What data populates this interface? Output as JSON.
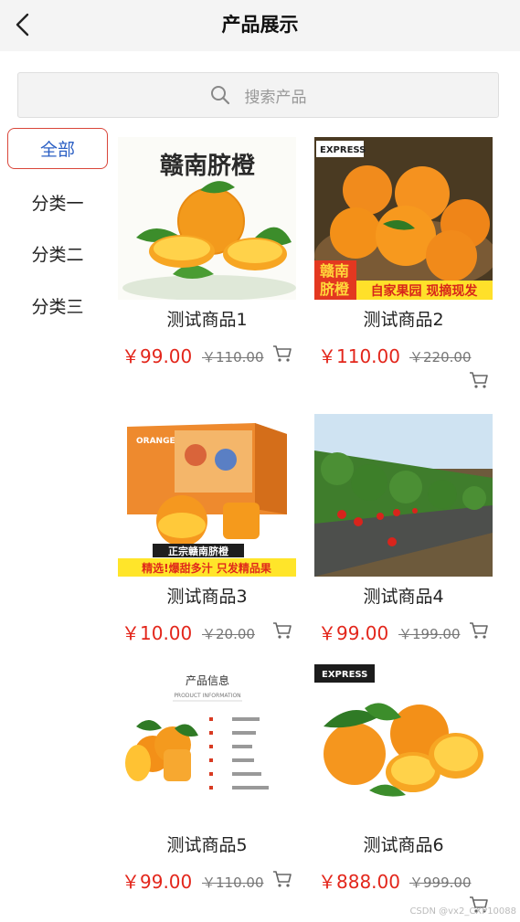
{
  "header": {
    "title": "产品展示",
    "back_icon": "chevron-left-icon"
  },
  "search": {
    "placeholder": "搜索产品",
    "icon": "search-icon"
  },
  "categories": [
    {
      "label": "全部",
      "active": true
    },
    {
      "label": "分类一",
      "active": false
    },
    {
      "label": "分类二",
      "active": false
    },
    {
      "label": "分类三",
      "active": false
    }
  ],
  "products": [
    {
      "name": "测试商品1",
      "price": "￥99.00",
      "old_price": "￥110.00",
      "image_text": [
        "赣南脐橙"
      ]
    },
    {
      "name": "测试商品2",
      "price": "￥110.00",
      "old_price": "￥220.00",
      "image_text": [
        "赣南",
        "脐橙",
        "自家果园 现摘现发",
        "EXPRESS"
      ]
    },
    {
      "name": "测试商品3",
      "price": "￥10.00",
      "old_price": "￥20.00",
      "image_text": [
        "正宗赣南脐橙",
        "精选!爆甜多汁 只发精品果",
        "ORANGE"
      ]
    },
    {
      "name": "测试商品4",
      "price": "￥99.00",
      "old_price": "￥199.00",
      "image_text": []
    },
    {
      "name": "测试商品5",
      "price": "￥99.00",
      "old_price": "￥110.00",
      "image_text": [
        "产品信息",
        "PRODUCT INFORMATION"
      ]
    },
    {
      "name": "测试商品6",
      "price": "￥888.00",
      "old_price": "￥999.00",
      "image_text": [
        "EXPRESS"
      ]
    }
  ],
  "colors": {
    "price": "#e3261b",
    "active_border": "#d9463a",
    "active_text": "#2b5fc4"
  },
  "watermark": "CSDN @vx2_CXP10088"
}
